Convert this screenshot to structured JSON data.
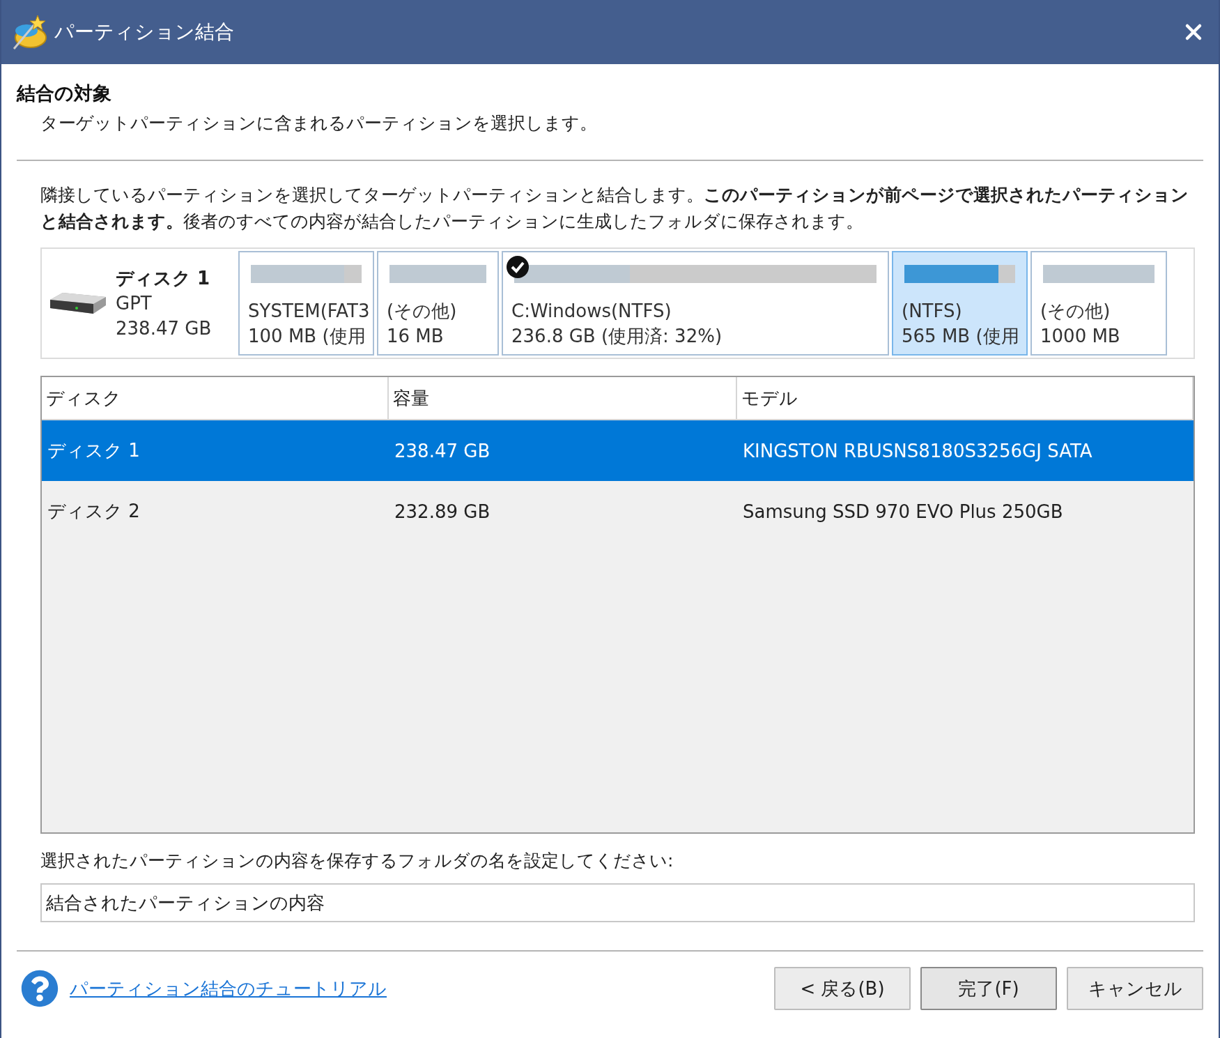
{
  "window": {
    "title": "パーティション結合"
  },
  "header": {
    "title": "結合の対象",
    "subtitle": "ターゲットパーティションに含まれるパーティションを選択します。"
  },
  "description": "隣接しているパーティションを選択してターゲットパーティションと結合します。**このパーティションが前ページで選択されたパーティションと結合されます。**後者のすべての内容が結合したパーティションに生成したフォルダに保存されます。",
  "disk_map": {
    "disk": {
      "name": "ディスク 1",
      "style": "GPT",
      "size": "238.47 GB"
    },
    "partitions": [
      {
        "label": "SYSTEM(FAT3",
        "size": "100 MB (使用",
        "level": 0.84,
        "selected": false,
        "checked": false
      },
      {
        "label": "(その他)",
        "size": "16 MB",
        "level": 1,
        "selected": false,
        "checked": false
      },
      {
        "label": "C:Windows(NTFS)",
        "size": "236.8 GB (使用済: 32%)",
        "level": 0.32,
        "selected": false,
        "checked": true
      },
      {
        "label": "(NTFS)",
        "size": "565 MB (使用",
        "level": 0.85,
        "selected": true,
        "checked": false
      },
      {
        "label": "(その他)",
        "size": "1000 MB",
        "level": 1,
        "selected": false,
        "checked": false
      }
    ]
  },
  "table": {
    "columns": [
      "ディスク",
      "容量",
      "モデル"
    ],
    "rows": [
      {
        "cells": [
          "ディスク 1",
          "238.47 GB",
          "KINGSTON RBUSNS8180S3256GJ SATA"
        ],
        "selected": true
      },
      {
        "cells": [
          "ディスク 2",
          "232.89 GB",
          "Samsung SSD 970 EVO Plus 250GB"
        ],
        "selected": false
      }
    ]
  },
  "folder": {
    "label": "選択されたパーティションの内容を保存するフォルダの名を設定してください:",
    "value": "結合されたパーティションの内容"
  },
  "footer": {
    "help_link": "パーティション結合のチュートリアル",
    "buttons": [
      {
        "label": "< 戻る(B)",
        "default": false
      },
      {
        "label": "完了(F)",
        "default": true
      },
      {
        "label": "キャンセル",
        "default": false
      }
    ]
  }
}
